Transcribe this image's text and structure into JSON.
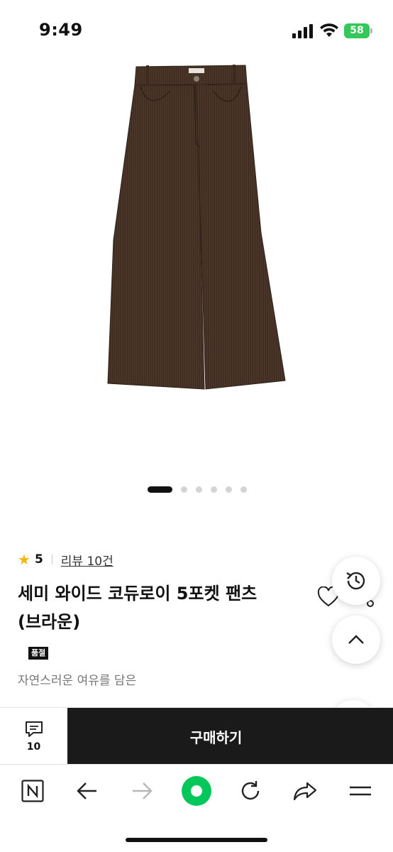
{
  "status_bar": {
    "time": "9:49",
    "battery_level": "58"
  },
  "product": {
    "image_alt": "brown corduroy wide pants",
    "carousel": {
      "total": 6,
      "active_index": 0
    },
    "rating": "5",
    "review_link": "리뷰 10건",
    "title_line1": "세미 와이드 코듀로이 5포켓 팬츠",
    "title_line2": "(브라운)",
    "badge": "품절",
    "description": "자연스러운 여유를 담은"
  },
  "purchase_bar": {
    "comment_count": "10",
    "buy_label": "구매하기"
  },
  "icons": {
    "star": "star-icon",
    "heart": "heart-icon",
    "share": "share-icon",
    "history": "history-icon",
    "scroll_top": "chevron-up-icon",
    "help": "question-icon",
    "comment": "comment-icon"
  },
  "browser_bar": {
    "items": [
      "naver-home",
      "back",
      "forward",
      "green-dot",
      "refresh",
      "share",
      "menu"
    ]
  },
  "colors": {
    "star": "#f5b50a",
    "battery": "#34c759",
    "buy_button": "#1a1a1a",
    "green_dot": "#03c75a",
    "pants": "#4a3528"
  }
}
